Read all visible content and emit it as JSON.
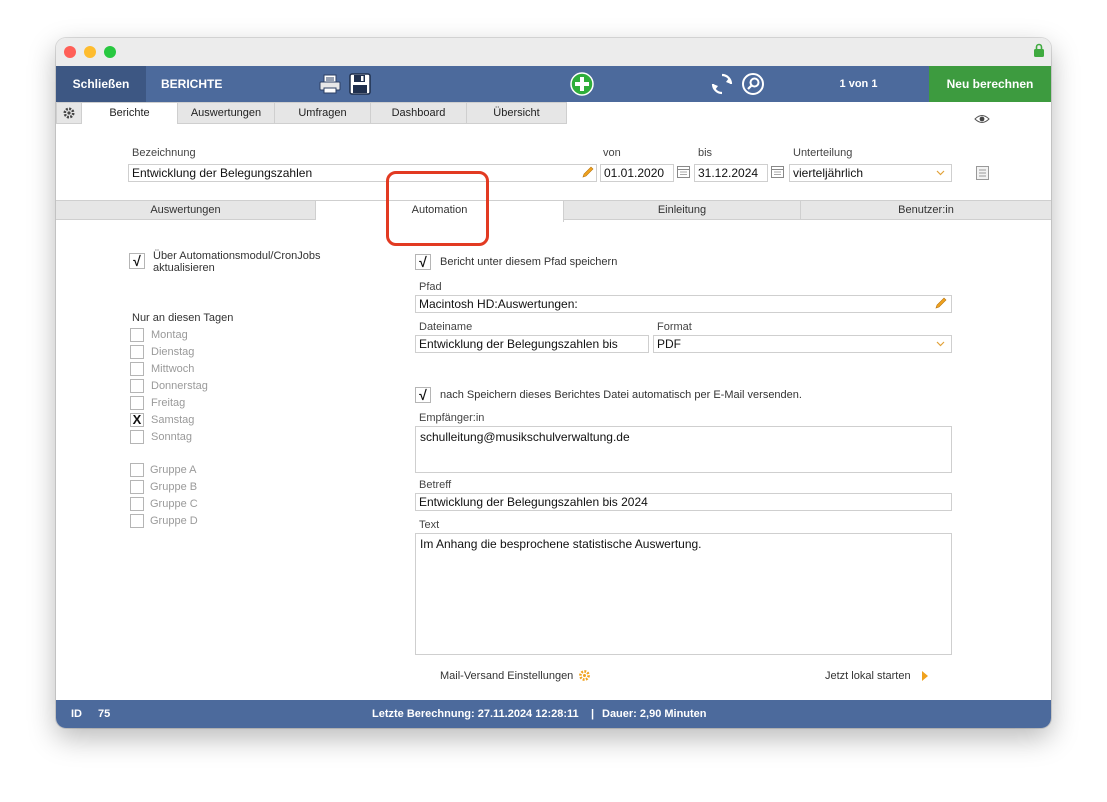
{
  "toolbar": {
    "close_label": "Schließen",
    "title": "BERICHTE",
    "record_count": "1 von 1",
    "recalc_label": "Neu berechnen"
  },
  "main_tabs": [
    "Berichte",
    "Auswertungen",
    "Umfragen",
    "Dashboard",
    "Übersicht"
  ],
  "form": {
    "bezeichnung_label": "Bezeichnung",
    "bezeichnung_value": "Entwicklung der Belegungszahlen",
    "von_label": "von",
    "von_value": "01.01.2020",
    "bis_label": "bis",
    "bis_value": "31.12.2024",
    "unterteilung_label": "Unterteilung",
    "unterteilung_value": "vierteljährlich"
  },
  "sub_tabs": [
    "Auswertungen",
    "Automation",
    "Einleitung",
    "Benutzer:in"
  ],
  "automation": {
    "cron_label_1": "Über Automationsmodul/CronJobs",
    "cron_label_2": "aktualisieren",
    "days_heading": "Nur an diesen Tagen",
    "days": [
      {
        "label": "Montag",
        "checked": false
      },
      {
        "label": "Dienstag",
        "checked": false
      },
      {
        "label": "Mittwoch",
        "checked": false
      },
      {
        "label": "Donnerstag",
        "checked": false
      },
      {
        "label": "Freitag",
        "checked": false
      },
      {
        "label": "Samstag",
        "checked": true
      },
      {
        "label": "Sonntag",
        "checked": false
      }
    ],
    "groups": [
      "Gruppe A",
      "Gruppe B",
      "Gruppe C",
      "Gruppe D"
    ],
    "save_path_label": "Bericht unter diesem Pfad speichern",
    "pfad_label": "Pfad",
    "pfad_value": "Macintosh HD:Auswertungen:",
    "dateiname_label": "Dateiname",
    "dateiname_value": "Entwicklung der Belegungszahlen bis",
    "format_label": "Format",
    "format_value": "PDF",
    "email_label": "nach Speichern dieses Berichtes Datei automatisch per E-Mail versenden.",
    "empfaenger_label": "Empfänger:in",
    "empfaenger_value": "schulleitung@musikschulverwaltung.de",
    "betreff_label": "Betreff",
    "betreff_value": "Entwicklung der Belegungszahlen bis 2024",
    "text_label": "Text",
    "text_value": "Im Anhang die besprochene statistische Auswertung.",
    "mail_settings_label": "Mail-Versand Einstellungen",
    "start_local_label": "Jetzt lokal starten",
    "check_mark": "√",
    "x_mark": "X"
  },
  "status": {
    "id_label": "ID",
    "id_value": "75",
    "last_calc": "Letzte Berechnung: 27.11.2024 12:28:11",
    "separator": "|",
    "duration": "Dauer: 2,90 Minuten"
  },
  "colors": {
    "toolbar_blue": "#4c6a9c",
    "recalc_green": "#3d9b3f",
    "highlight_red": "#e23a22"
  }
}
